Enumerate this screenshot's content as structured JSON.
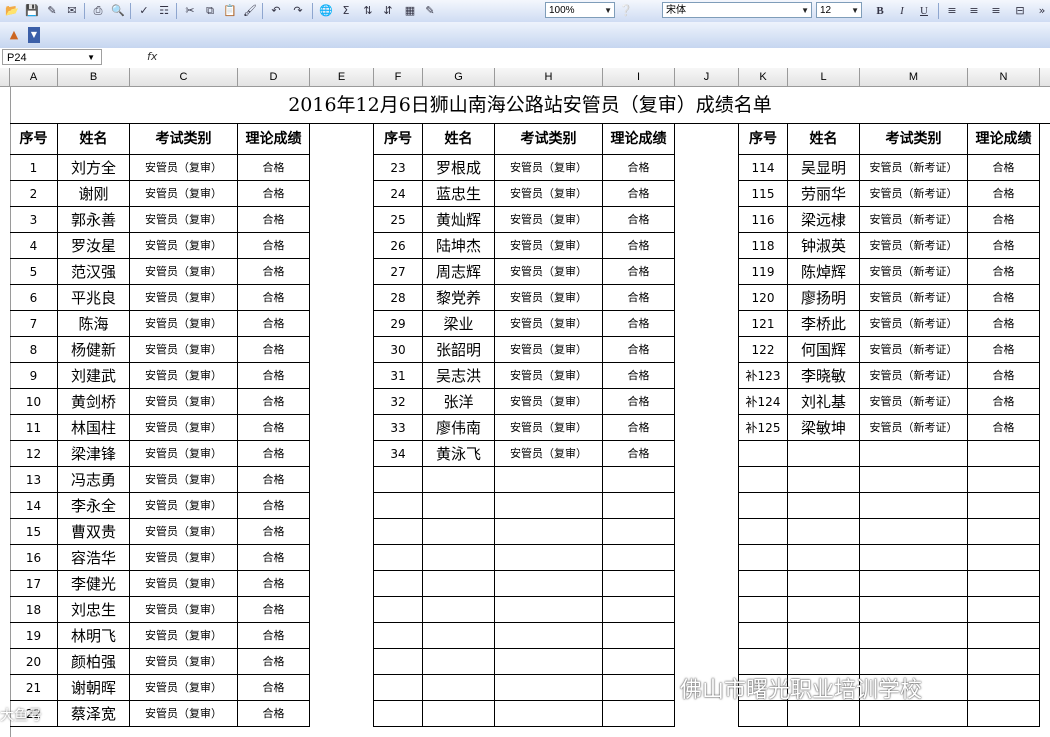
{
  "toolbar": {
    "zoom": "100%",
    "font": "宋体",
    "font_size": "12",
    "bold": "B",
    "italic": "I",
    "underline": "U"
  },
  "formula_bar": {
    "cell_ref": "P24",
    "fx_label": "fx",
    "value": ""
  },
  "columns": [
    "A",
    "B",
    "C",
    "D",
    "E",
    "F",
    "G",
    "H",
    "I",
    "J",
    "K",
    "L",
    "M",
    "N"
  ],
  "sheet_title": "2016年12月6日狮山南海公路站安管员（复审）成绩名单",
  "headers": [
    "序号",
    "姓名",
    "考试类别",
    "理论成绩"
  ],
  "group1": [
    [
      "1",
      "刘方全",
      "安管员（复审）",
      "合格"
    ],
    [
      "2",
      "谢刚",
      "安管员（复审）",
      "合格"
    ],
    [
      "3",
      "郭永善",
      "安管员（复审）",
      "合格"
    ],
    [
      "4",
      "罗汝星",
      "安管员（复审）",
      "合格"
    ],
    [
      "5",
      "范汉强",
      "安管员（复审）",
      "合格"
    ],
    [
      "6",
      "平兆良",
      "安管员（复审）",
      "合格"
    ],
    [
      "7",
      "陈海",
      "安管员（复审）",
      "合格"
    ],
    [
      "8",
      "杨健新",
      "安管员（复审）",
      "合格"
    ],
    [
      "9",
      "刘建武",
      "安管员（复审）",
      "合格"
    ],
    [
      "10",
      "黄剑桥",
      "安管员（复审）",
      "合格"
    ],
    [
      "11",
      "林国柱",
      "安管员（复审）",
      "合格"
    ],
    [
      "12",
      "梁津锋",
      "安管员（复审）",
      "合格"
    ],
    [
      "13",
      "冯志勇",
      "安管员（复审）",
      "合格"
    ],
    [
      "14",
      "李永全",
      "安管员（复审）",
      "合格"
    ],
    [
      "15",
      "曹双贵",
      "安管员（复审）",
      "合格"
    ],
    [
      "16",
      "容浩华",
      "安管员（复审）",
      "合格"
    ],
    [
      "17",
      "李健光",
      "安管员（复审）",
      "合格"
    ],
    [
      "18",
      "刘忠生",
      "安管员（复审）",
      "合格"
    ],
    [
      "19",
      "林明飞",
      "安管员（复审）",
      "合格"
    ],
    [
      "20",
      "颜柏强",
      "安管员（复审）",
      "合格"
    ],
    [
      "21",
      "谢朝晖",
      "安管员（复审）",
      "合格"
    ],
    [
      "22",
      "蔡泽宽",
      "安管员（复审）",
      "合格"
    ]
  ],
  "group2": [
    [
      "23",
      "罗根成",
      "安管员（复审）",
      "合格"
    ],
    [
      "24",
      "蓝忠生",
      "安管员（复审）",
      "合格"
    ],
    [
      "25",
      "黄灿辉",
      "安管员（复审）",
      "合格"
    ],
    [
      "26",
      "陆坤杰",
      "安管员（复审）",
      "合格"
    ],
    [
      "27",
      "周志辉",
      "安管员（复审）",
      "合格"
    ],
    [
      "28",
      "黎党养",
      "安管员（复审）",
      "合格"
    ],
    [
      "29",
      "梁业",
      "安管员（复审）",
      "合格"
    ],
    [
      "30",
      "张韶明",
      "安管员（复审）",
      "合格"
    ],
    [
      "31",
      "吴志洪",
      "安管员（复审）",
      "合格"
    ],
    [
      "32",
      "张洋",
      "安管员（复审）",
      "合格"
    ],
    [
      "33",
      "廖伟南",
      "安管员（复审）",
      "合格"
    ],
    [
      "34",
      "黄泳飞",
      "安管员（复审）",
      "合格"
    ]
  ],
  "group3": [
    [
      "114",
      "吴显明",
      "安管员（新考证）",
      "合格"
    ],
    [
      "115",
      "劳丽华",
      "安管员（新考证）",
      "合格"
    ],
    [
      "116",
      "梁远棣",
      "安管员（新考证）",
      "合格"
    ],
    [
      "118",
      "钟淑英",
      "安管员（新考证）",
      "合格"
    ],
    [
      "119",
      "陈焯辉",
      "安管员（新考证）",
      "合格"
    ],
    [
      "120",
      "廖扬明",
      "安管员（新考证）",
      "合格"
    ],
    [
      "121",
      "李桥此",
      "安管员（新考证）",
      "合格"
    ],
    [
      "122",
      "何国辉",
      "安管员（新考证）",
      "合格"
    ],
    [
      "补123",
      "李晓敏",
      "安管员（新考证）",
      "合格"
    ],
    [
      "补124",
      "刘礼基",
      "安管员（新考证）",
      "合格"
    ],
    [
      "补125",
      "梁敏坤",
      "安管员（新考证）",
      "合格"
    ]
  ],
  "watermark": "佛山市曙光职业培训学校",
  "watermark_corner": "大鱼号"
}
